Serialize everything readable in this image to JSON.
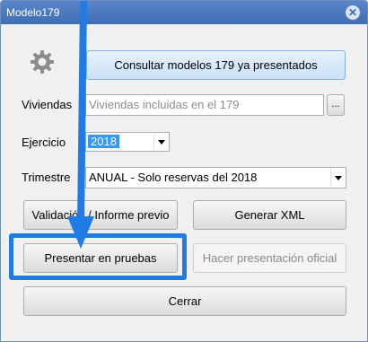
{
  "window": {
    "title": "Modelo179",
    "close_glyph": "✕"
  },
  "buttons": {
    "consultar": "Consultar modelos 179 ya presentados",
    "validacion": "Validación / Informe previo",
    "generar_xml": "Generar XML",
    "presentar_pruebas": "Presentar en pruebas",
    "presentacion_oficial": "Hacer presentación oficial",
    "cerrar": "Cerrar",
    "browse": "..."
  },
  "fields": {
    "viviendas": {
      "label": "Viviendas",
      "placeholder": "Viviendas incluidas en el 179"
    },
    "ejercicio": {
      "label": "Ejercicio",
      "value": "2018"
    },
    "trimestre": {
      "label": "Trimestre",
      "value": "ANUAL - Solo reservas del 2018"
    }
  },
  "annotation": {
    "color": "#1f7ce5"
  },
  "icons": {
    "gear": "gear-icon",
    "arrow": "annotation-arrow-icon"
  }
}
